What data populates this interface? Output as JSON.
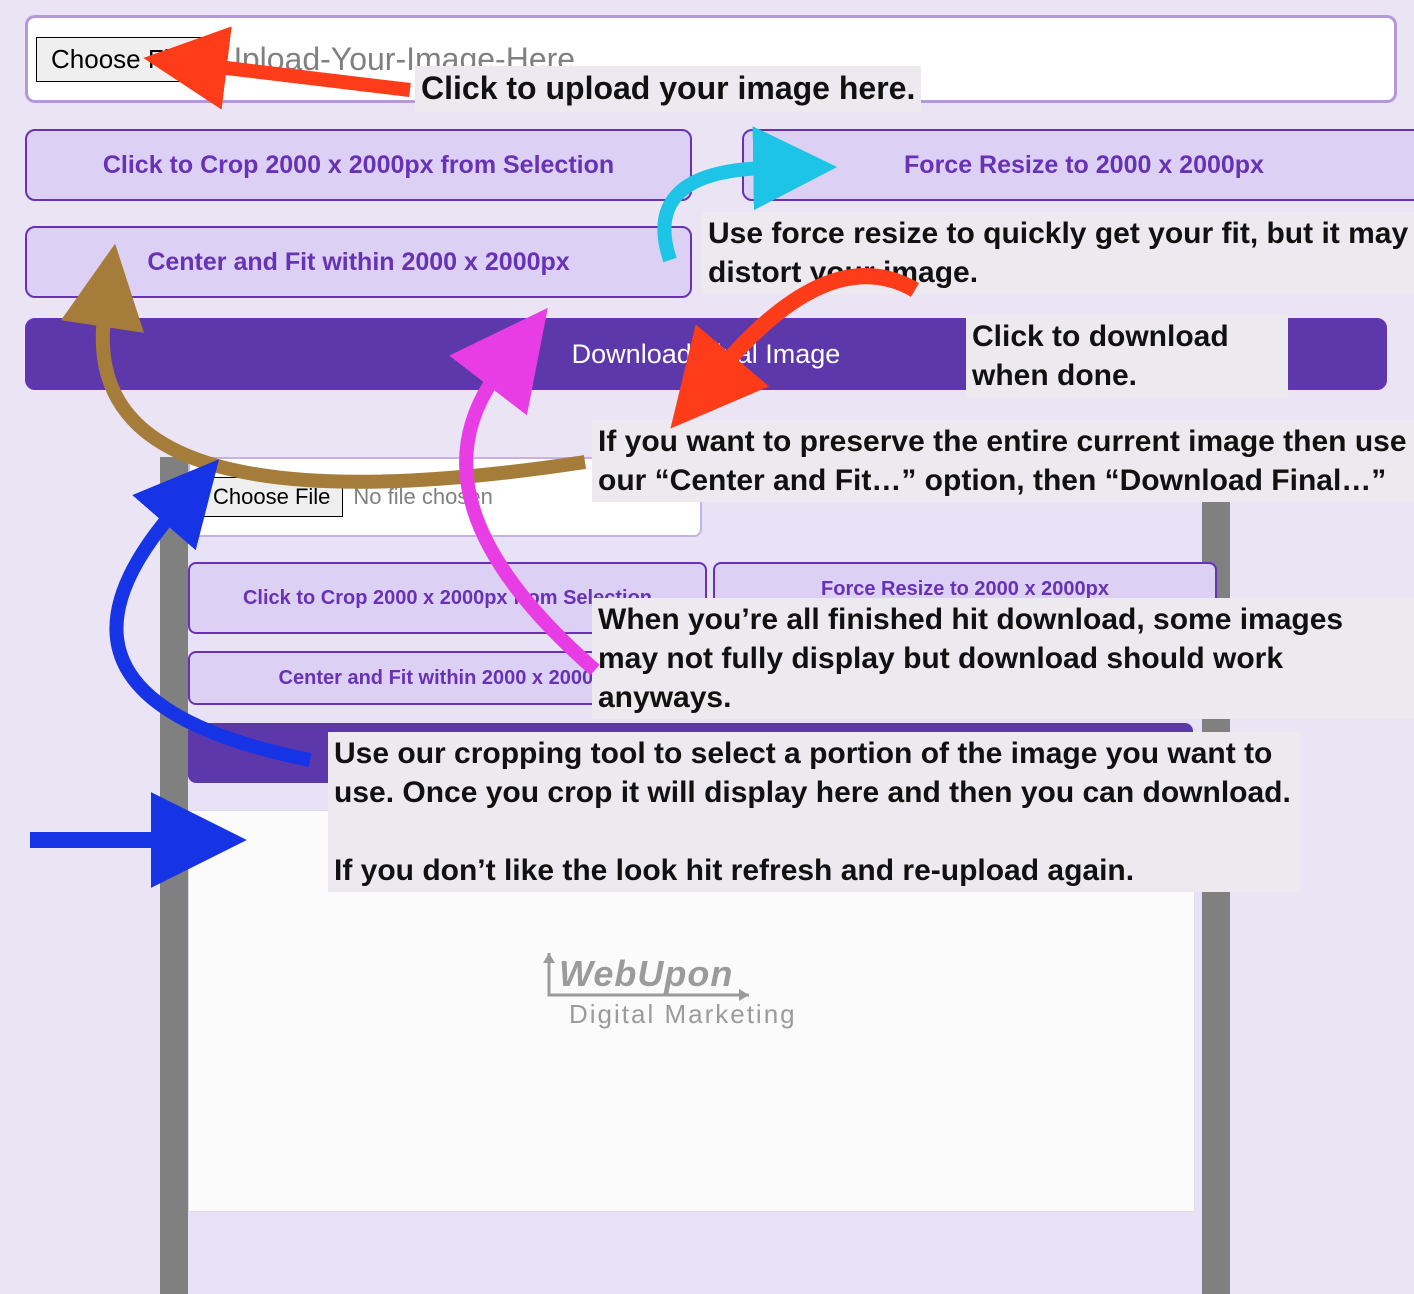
{
  "outer": {
    "file": {
      "button": "Choose File",
      "placeholder": "Upload-Your-Image-Here"
    },
    "crop": "Click to Crop 2000 x 2000px from Selection",
    "force": "Force Resize to 2000 x 2000px",
    "center": "Center and Fit within 2000 x 2000px",
    "download": "Download Final Image"
  },
  "inner": {
    "file": {
      "button": "Choose File",
      "placeholder": "No file chosen"
    },
    "crop": "Click to Crop 2000 x 2000px from Selection",
    "force": "Force Resize to 2000 x 2000px",
    "center": "Center and Fit within 2000 x 2000px",
    "logo": "WebUpon",
    "logo_sub": "Digital Marketing"
  },
  "annotations": {
    "a": "Click to upload your image here.",
    "b": "Use force resize to quickly get your fit, but it may distort your image.",
    "c": "Click to download when done.",
    "d": "If you want to preserve the entire current image then use our “Center and Fit…” option, then “Download Final…”",
    "e": "When you’re all finished hit download, some images may not fully display but download should work anyways.",
    "f": "Use our cropping tool to select a portion of the image you want to use. Once you crop it will display here and then you can download.\n\nIf you don’t like the look hit refresh and re-upload again."
  },
  "colors": {
    "arrow_red": "#ff3c1a",
    "arrow_cyan": "#1ec4e5",
    "arrow_brown": "#a57c3a",
    "arrow_magenta": "#e83de4",
    "arrow_blue": "#1633e6"
  }
}
